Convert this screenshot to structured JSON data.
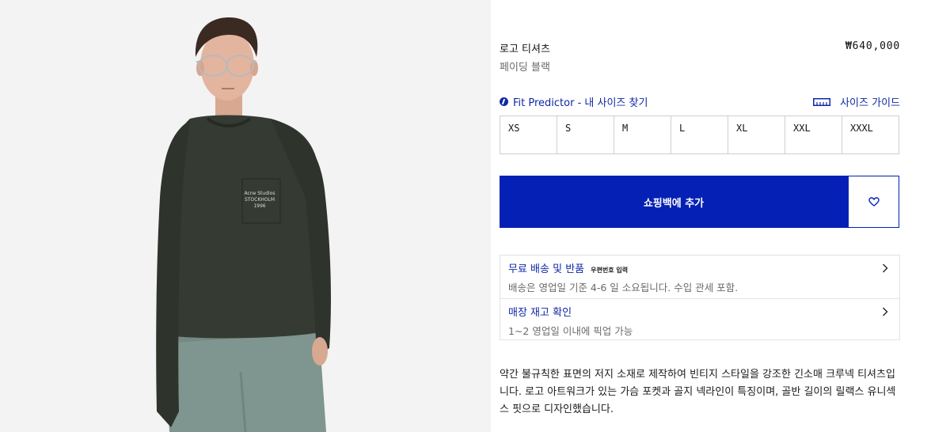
{
  "product": {
    "name": "로고 티셔츠",
    "price": "₩640,000",
    "color": "페이딩 블랙",
    "print_lines": [
      "Acne Studios",
      "STOCKHOLM",
      "1996"
    ]
  },
  "fit": {
    "predictor_label": "Fit Predictor - 내 사이즈 찾기",
    "predictor_icon": "fit-predictor-icon",
    "guide_label": "사이즈 가이드",
    "guide_icon": "ruler-icon"
  },
  "sizes": [
    "XS",
    "S",
    "M",
    "L",
    "XL",
    "XXL",
    "XXXL"
  ],
  "cart": {
    "add_label": "쇼핑백에 추가",
    "wishlist_icon": "heart-icon"
  },
  "shipping": {
    "title": "무료 배송 및 반품",
    "postcode_label": "우편번호 입력",
    "desc": "배송은 영업일 기준 4-6 일 소요됩니다. 수입 관세 포함."
  },
  "stock": {
    "title": "매장 재고 확인",
    "desc": "1~2 영업일 이내에 픽업 가능"
  },
  "description": "약간 불규칙한 표면의 저지 소재로 제작하여 빈티지 스타일을 강조한 긴소매 크루넥 티셔츠입니다. 로고 아트워크가 있는 가슴 포켓과 골지 넥라인이 특징이며, 골반 길이의 릴랙스 유니섹스 핏으로 디자인했습니다.",
  "colors": {
    "accent": "#0520b5",
    "link": "#1028a5",
    "muted_text": "#6b6b6b",
    "image_bg": "#f3f3f3",
    "shirt": "#353b33",
    "pants": "#7f958f"
  }
}
